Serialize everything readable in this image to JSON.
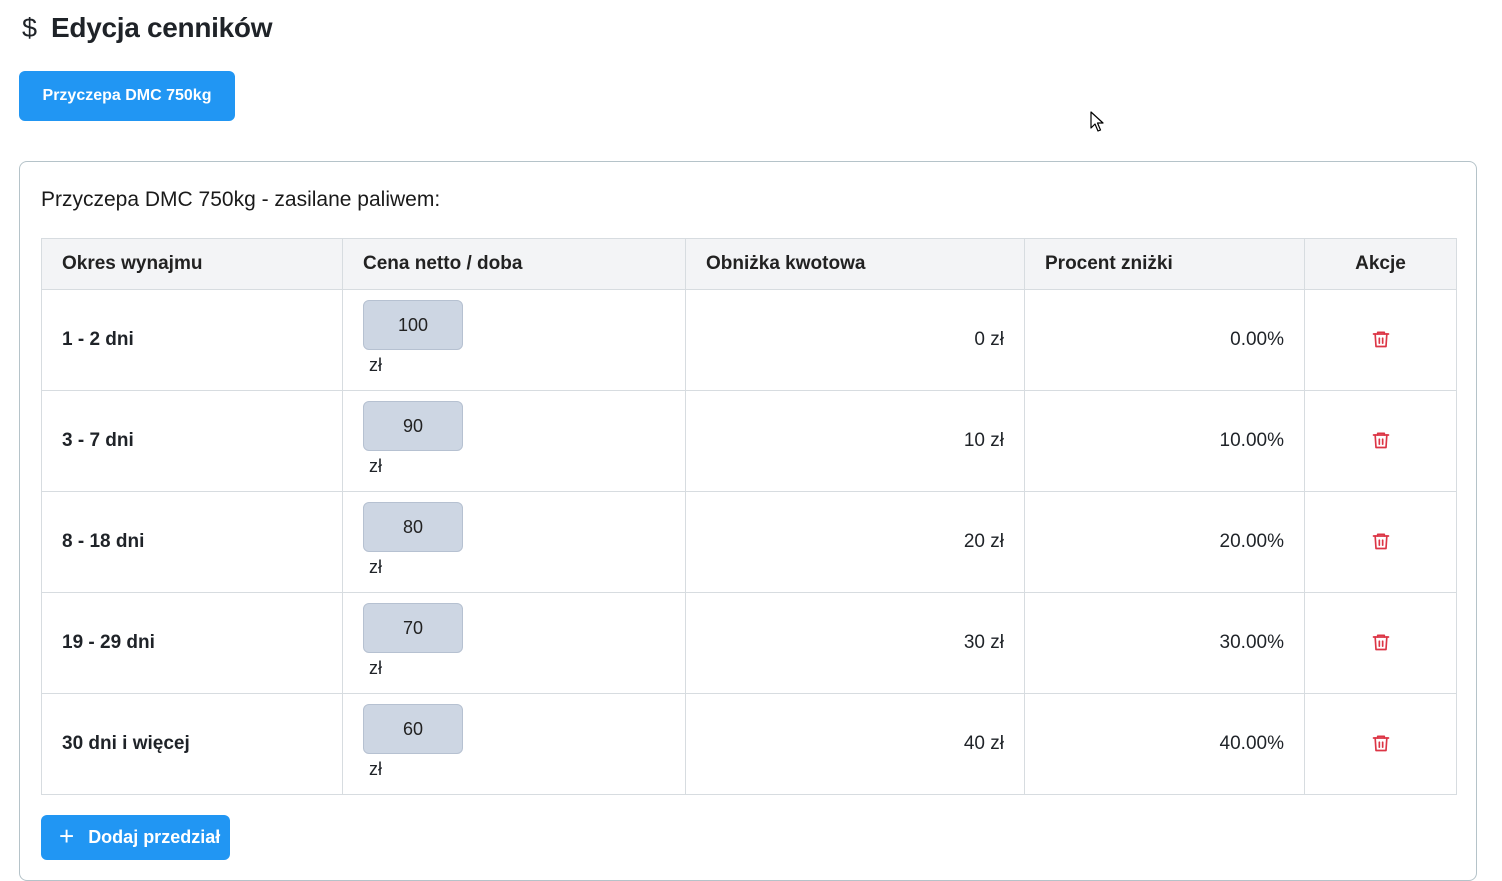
{
  "header": {
    "icon": "dollar-icon",
    "icon_glyph": "$",
    "title": "Edycja cenników"
  },
  "tabs": [
    {
      "label": "Przyczepa DMC 750kg",
      "active": true
    }
  ],
  "card": {
    "title": "Przyczepa DMC 750kg - zasilane paliwem:",
    "columns": [
      "Okres wynajmu",
      "Cena netto / doba",
      "Obniżka kwotowa",
      "Procent zniżki",
      "Akcje"
    ],
    "rows": [
      {
        "period": "1 - 2 dni",
        "price": "100",
        "currency": "zł",
        "discount_amount": "0 zł",
        "discount_percent": "0.00%"
      },
      {
        "period": "3 - 7 dni",
        "price": "90",
        "currency": "zł",
        "discount_amount": "10 zł",
        "discount_percent": "10.00%"
      },
      {
        "period": "8 - 18 dni",
        "price": "80",
        "currency": "zł",
        "discount_amount": "20 zł",
        "discount_percent": "20.00%"
      },
      {
        "period": "19 - 29 dni",
        "price": "70",
        "currency": "zł",
        "discount_amount": "30 zł",
        "discount_percent": "30.00%"
      },
      {
        "period": "30 dni i więcej",
        "price": "60",
        "currency": "zł",
        "discount_amount": "40 zł",
        "discount_percent": "40.00%"
      }
    ],
    "add_button": {
      "icon": "plus-icon",
      "icon_glyph": "+",
      "label": "Dodaj przedział"
    }
  },
  "colors": {
    "primary": "#2196f3",
    "danger": "#dc3545",
    "input_bg": "#cdd6e3",
    "header_bg": "#f3f4f6"
  }
}
